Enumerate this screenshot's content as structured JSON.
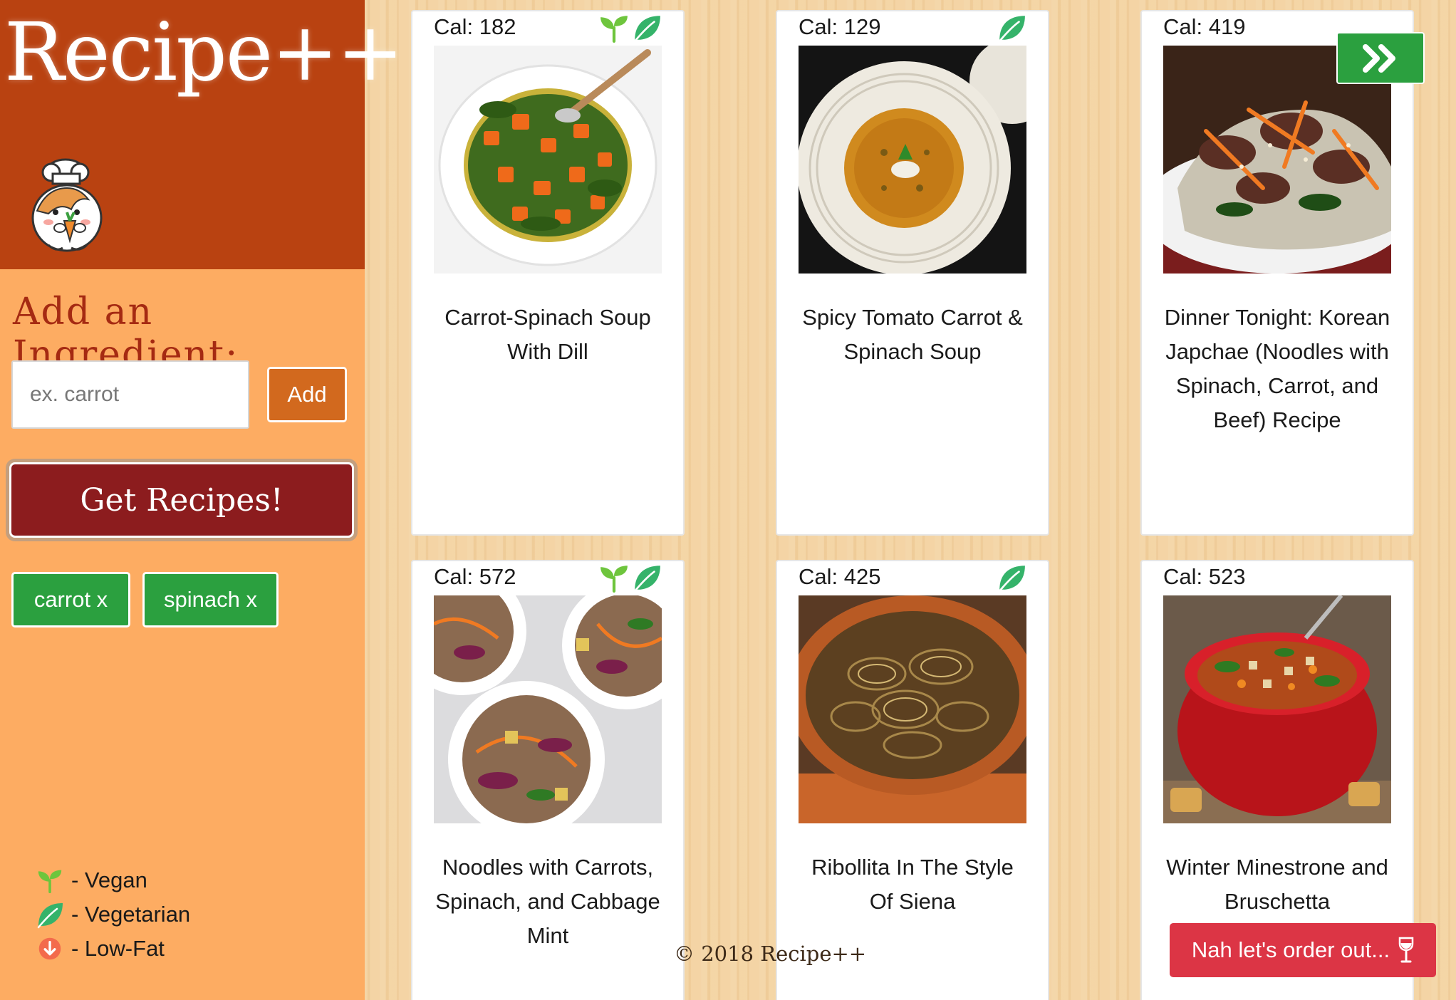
{
  "app": {
    "logo": "Recipe++",
    "copyright": "© 2018 Recipe++"
  },
  "sidebar": {
    "add_heading": "Add an Ingredient:",
    "ingredient_input": {
      "value": "",
      "placeholder": "ex. carrot"
    },
    "add_label": "Add",
    "get_recipes_label": "Get Recipes!",
    "chips": [
      "carrot x",
      "spinach x"
    ],
    "legend": [
      "- Vegan",
      "- Vegetarian",
      "- Low-Fat"
    ]
  },
  "recipes": [
    {
      "cal": "Cal: 182",
      "title": "Carrot-Spinach Soup With Dill",
      "vegan": true,
      "vegetarian": true
    },
    {
      "cal": "Cal: 129",
      "title": "Spicy Tomato Carrot & Spinach Soup",
      "vegan": false,
      "vegetarian": true
    },
    {
      "cal": "Cal: 419",
      "title": "Dinner Tonight: Korean Japchae (Noodles with Spinach, Carrot, and Beef) Recipe",
      "vegan": false,
      "vegetarian": false
    },
    {
      "cal": "Cal: 572",
      "title": "Noodles with Carrots, Spinach, and Cabbage Mint",
      "vegan": true,
      "vegetarian": true
    },
    {
      "cal": "Cal: 425",
      "title": "Ribollita In The Style Of Siena",
      "vegan": false,
      "vegetarian": true
    },
    {
      "cal": "Cal: 523",
      "title": "Winter Minestrone and Bruschetta",
      "vegan": false,
      "vegetarian": false
    }
  ],
  "actions": {
    "order_out_label": "Nah let's order out..."
  },
  "icons": {
    "vegan": "sprout-icon",
    "vegetarian": "leaf-icon",
    "low_fat": "down-arrow-circle-icon",
    "next": "double-chevron-right-icon",
    "wine": "wine-glass-icon"
  },
  "colors": {
    "header": "#b94211",
    "sidebar": "#fdac62",
    "primary_green": "#2ba03f",
    "get_recipes": "#8c1c1e",
    "add_button": "#d2691e",
    "order_out": "#dc3545",
    "vegan_green": "#6ec53d",
    "vegetarian_green": "#35b36a",
    "low_fat": "#f36b4c"
  }
}
